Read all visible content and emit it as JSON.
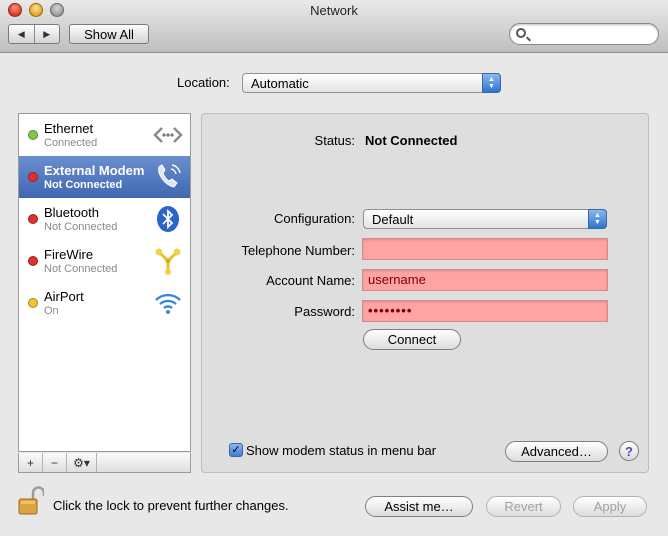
{
  "window": {
    "title": "Network"
  },
  "toolbar": {
    "back_glyph": "◀",
    "forward_glyph": "▶",
    "show_all_label": "Show All",
    "search_value": ""
  },
  "location": {
    "label": "Location:",
    "value": "Automatic"
  },
  "services": [
    {
      "name": "Ethernet",
      "status": "Connected",
      "dot_color": "#7fc84a",
      "icon": "ethernet-icon",
      "selected": false
    },
    {
      "name": "External Modem",
      "status": "Not Connected",
      "dot_color": "#e03030",
      "icon": "phone-icon",
      "selected": true
    },
    {
      "name": "Bluetooth",
      "status": "Not Connected",
      "dot_color": "#e03030",
      "icon": "bluetooth-icon",
      "selected": false
    },
    {
      "name": "FireWire",
      "status": "Not Connected",
      "dot_color": "#e03030",
      "icon": "firewire-icon",
      "selected": false
    },
    {
      "name": "AirPort",
      "status": "On",
      "dot_color": "#f2c230",
      "icon": "wifi-icon",
      "selected": false
    }
  ],
  "list_controls": {
    "add": "+",
    "remove": "−",
    "gear": "⚙▾"
  },
  "detail": {
    "status_label": "Status:",
    "status_value": "Not Connected",
    "configuration_label": "Configuration:",
    "configuration_value": "Default",
    "telephone_label": "Telephone Number:",
    "telephone_value": "",
    "account_label": "Account Name:",
    "account_value": "username",
    "password_label": "Password:",
    "password_value": "••••••••",
    "connect_label": "Connect",
    "show_modem_label": "Show modem status in menu bar",
    "show_modem_checked": true,
    "advanced_label": "Advanced…",
    "help_label": "?"
  },
  "footer": {
    "lock_text": "Click the lock to prevent further changes.",
    "assist_label": "Assist me…",
    "revert_label": "Revert",
    "apply_label": "Apply"
  },
  "colors": {
    "selection": "#4a72bd",
    "invalid_field": "#ffa3a3",
    "popup_arrows": "#3f7ad4"
  }
}
